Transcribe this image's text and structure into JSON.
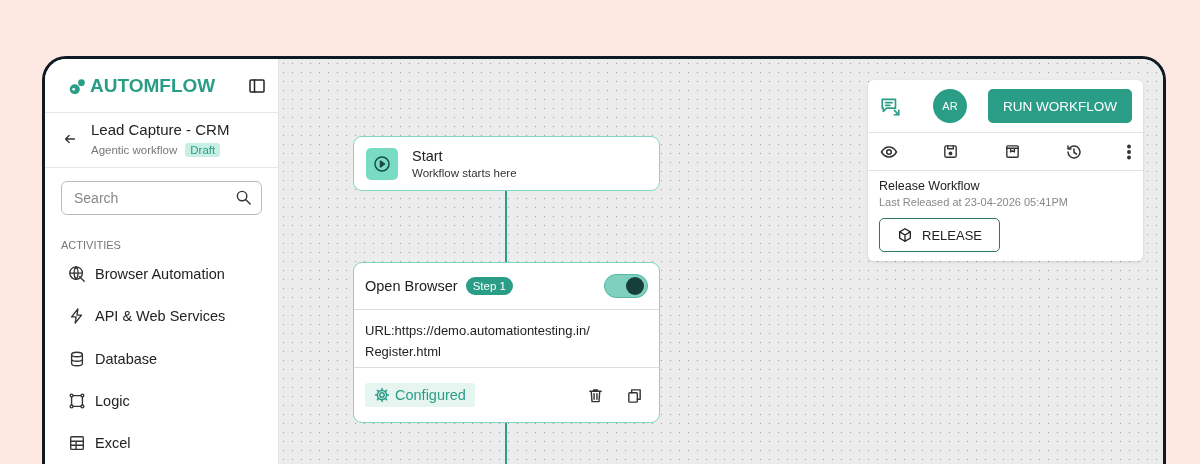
{
  "brand": {
    "name": "AUTOMFLOW"
  },
  "workflow": {
    "title": "Lead Capture - CRM",
    "subtitle": "Agentic workflow",
    "status": "Draft"
  },
  "search": {
    "placeholder": "Search"
  },
  "activities": {
    "heading": "ACTIVITIES",
    "items": [
      {
        "label": "Browser Automation",
        "kind": "browser"
      },
      {
        "label": "API & Web Services",
        "kind": "api"
      },
      {
        "label": "Database",
        "kind": "database"
      },
      {
        "label": "Logic",
        "kind": "logic"
      },
      {
        "label": "Excel",
        "kind": "excel"
      }
    ]
  },
  "nodes": [
    {
      "kind": "start",
      "title": "Start",
      "subtitle": "Workflow starts here"
    },
    {
      "kind": "step",
      "title": "Open Browser",
      "badge": "Step 1",
      "enabled": true,
      "detail": "URL:https://demo.automationtesting.in/Register.html",
      "status": "Configured"
    }
  ],
  "toolbar": {
    "avatar": "AR",
    "run_button": "RUN WORKFLOW",
    "release": {
      "title": "Release Workflow",
      "subtitle": "Last Released at 23-04-2026 05:41PM",
      "button": "RELEASE"
    }
  }
}
